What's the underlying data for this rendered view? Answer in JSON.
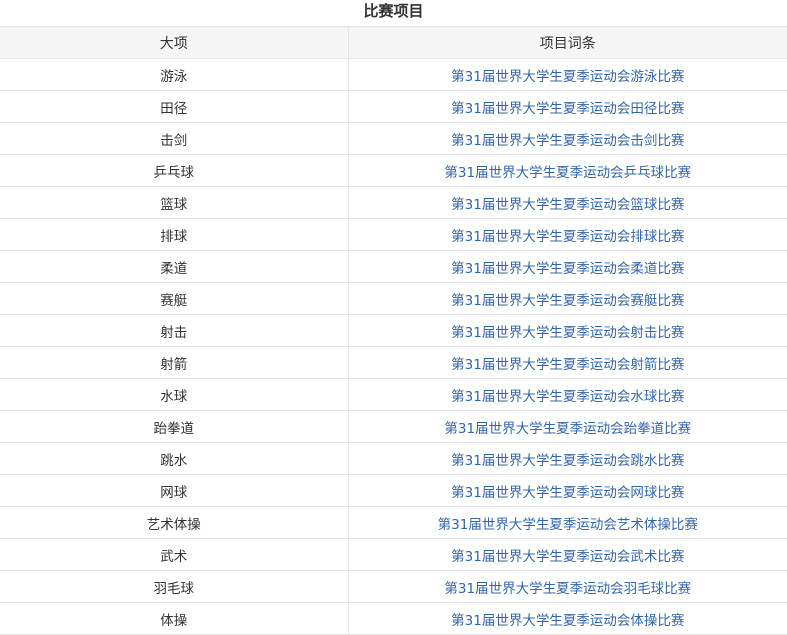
{
  "table": {
    "caption": "比赛项目",
    "headers": [
      "大项",
      "项目词条"
    ],
    "rows": [
      {
        "sport": "游泳",
        "entry": "第31届世界大学生夏季运动会游泳比赛"
      },
      {
        "sport": "田径",
        "entry": "第31届世界大学生夏季运动会田径比赛"
      },
      {
        "sport": "击剑",
        "entry": "第31届世界大学生夏季运动会击剑比赛"
      },
      {
        "sport": "乒乓球",
        "entry": "第31届世界大学生夏季运动会乒乓球比赛"
      },
      {
        "sport": "篮球",
        "entry": "第31届世界大学生夏季运动会篮球比赛"
      },
      {
        "sport": "排球",
        "entry": "第31届世界大学生夏季运动会排球比赛"
      },
      {
        "sport": "柔道",
        "entry": "第31届世界大学生夏季运动会柔道比赛"
      },
      {
        "sport": "赛艇",
        "entry": "第31届世界大学生夏季运动会赛艇比赛"
      },
      {
        "sport": "射击",
        "entry": "第31届世界大学生夏季运动会射击比赛"
      },
      {
        "sport": "射箭",
        "entry": "第31届世界大学生夏季运动会射箭比赛"
      },
      {
        "sport": "水球",
        "entry": "第31届世界大学生夏季运动会水球比赛"
      },
      {
        "sport": "跆拳道",
        "entry": "第31届世界大学生夏季运动会跆拳道比赛"
      },
      {
        "sport": "跳水",
        "entry": "第31届世界大学生夏季运动会跳水比赛"
      },
      {
        "sport": "网球",
        "entry": "第31届世界大学生夏季运动会网球比赛"
      },
      {
        "sport": "艺术体操",
        "entry": "第31届世界大学生夏季运动会艺术体操比赛"
      },
      {
        "sport": "武术",
        "entry": "第31届世界大学生夏季运动会武术比赛"
      },
      {
        "sport": "羽毛球",
        "entry": "第31届世界大学生夏季运动会羽毛球比赛"
      },
      {
        "sport": "体操",
        "entry": "第31届世界大学生夏季运动会体操比赛"
      }
    ]
  },
  "colors": {
    "link": "#3366aa",
    "header_bg": "#f5f5f5",
    "border": "#e6e6e6",
    "text": "#333333"
  }
}
